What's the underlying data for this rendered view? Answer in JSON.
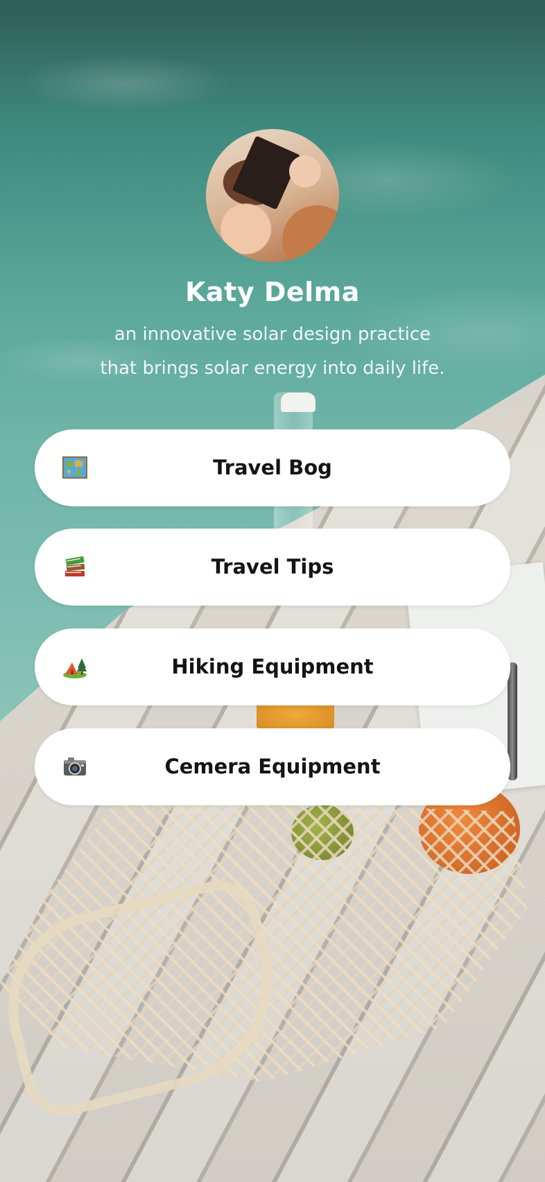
{
  "profile": {
    "name": "Katy Delma",
    "bio_line1": "an innovative solar design practice",
    "bio_line2": "that brings solar energy into daily life."
  },
  "links": [
    {
      "label": "Travel Bog",
      "icon": "world-map-icon"
    },
    {
      "label": "Travel Tips",
      "icon": "books-icon"
    },
    {
      "label": "Hiking Equipment",
      "icon": "camping-tent-icon"
    },
    {
      "label": "Cemera Equipment",
      "icon": "camera-icon"
    }
  ],
  "colors": {
    "button_bg": "#ffffff",
    "button_text": "#141414",
    "name_text": "#ffffff"
  }
}
